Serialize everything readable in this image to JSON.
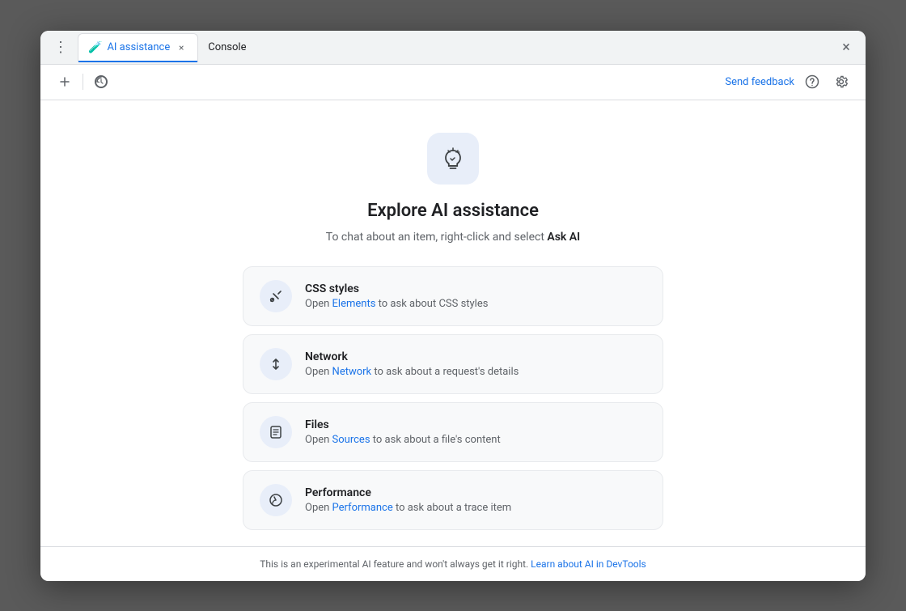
{
  "window": {
    "close_label": "×"
  },
  "titlebar": {
    "active_tab": {
      "label": "AI assistance",
      "icon": "🧪",
      "close": "×"
    },
    "inactive_tab": {
      "label": "Console"
    }
  },
  "toolbar": {
    "new_tab_label": "+",
    "history_icon": "history",
    "send_feedback": "Send feedback",
    "help_icon": "?",
    "settings_icon": "⚙"
  },
  "main": {
    "title": "Explore AI assistance",
    "subtitle_prefix": "To chat about an item, right-click and select ",
    "subtitle_bold": "Ask AI",
    "features": [
      {
        "id": "css",
        "title": "CSS styles",
        "desc_prefix": "Open ",
        "link_text": "Elements",
        "desc_suffix": " to ask about CSS styles"
      },
      {
        "id": "network",
        "title": "Network",
        "desc_prefix": "Open ",
        "link_text": "Network",
        "desc_suffix": " to ask about a request's details"
      },
      {
        "id": "files",
        "title": "Files",
        "desc_prefix": "Open ",
        "link_text": "Sources",
        "desc_suffix": " to ask about a file's content"
      },
      {
        "id": "performance",
        "title": "Performance",
        "desc_prefix": "Open ",
        "link_text": "Performance",
        "desc_suffix": " to ask about a trace item"
      }
    ]
  },
  "footer": {
    "text": "This is an experimental AI feature and won't always get it right. ",
    "link_text": "Learn about AI in DevTools"
  }
}
